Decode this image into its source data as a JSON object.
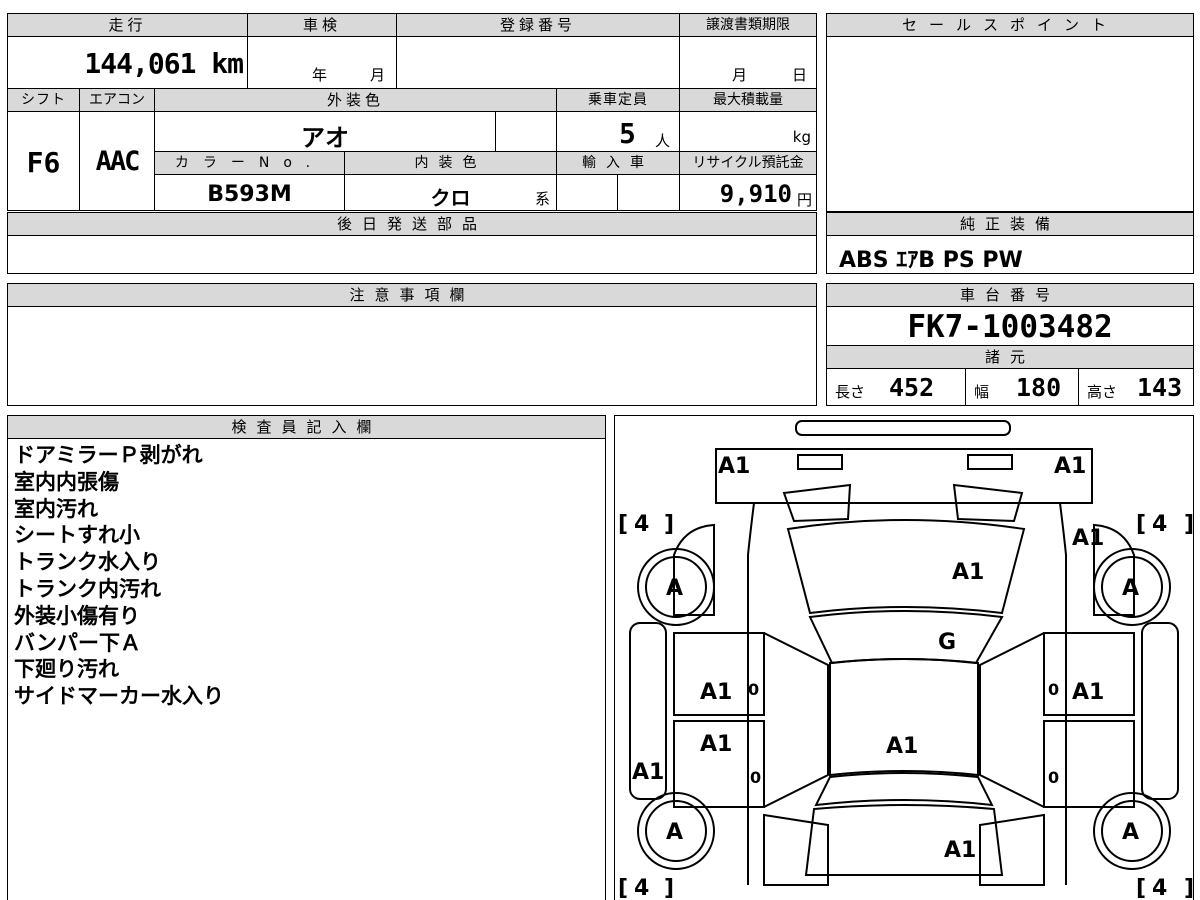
{
  "vehicle": {
    "mileage_header": "走行",
    "mileage_value": "144,061 km",
    "inspection_header": "車検",
    "inspection_year_unit": "年",
    "inspection_month_unit": "月",
    "registration_header": "登録番号",
    "transfer_deadline_header": "譲渡書類期限",
    "transfer_month_unit": "月",
    "transfer_day_unit": "日",
    "shift_header": "シフト",
    "shift_value": "F6",
    "aircon_header": "エアコン",
    "aircon_value": "AAC",
    "exterior_color_header": "外装色",
    "exterior_color_value": "アオ",
    "capacity_header": "乗車定員",
    "capacity_value": "5",
    "capacity_unit": "人",
    "max_load_header": "最大積載量",
    "max_load_unit": "kg",
    "color_no_header": "カラーNo.",
    "color_no_value": "B593M",
    "interior_color_header": "内装色",
    "interior_color_value": "クロ",
    "interior_color_suffix": "系",
    "import_header": "輸入車",
    "recycle_header": "リサイクル預託金",
    "recycle_value": "9,910",
    "recycle_unit": "円",
    "later_parts_header": "後日発送部品"
  },
  "sales_point": {
    "header": "セールスポイント"
  },
  "equipment": {
    "header": "純正装備",
    "value": "ABS ｴｱB PS PW"
  },
  "caution": {
    "header": "注意事項欄"
  },
  "chassis": {
    "header": "車台番号",
    "value": "FK7-1003482"
  },
  "specs": {
    "header": "諸元",
    "length_label": "長さ",
    "length_value": "452",
    "width_label": "幅",
    "width_value": "180",
    "height_label": "高さ",
    "height_value": "143"
  },
  "inspector": {
    "header": "検査員記入欄",
    "notes": [
      "ドアミラーＰ剥がれ",
      "室内内張傷",
      "室内汚れ",
      "シートすれ小",
      "トランク水入り",
      "トランク内汚れ",
      "外装小傷有り",
      "バンパー下Ａ",
      "下廻り汚れ",
      "サイドマーカー水入り"
    ]
  },
  "diagram": {
    "tire_fl": "4",
    "tire_fr": "4",
    "tire_rl": "4",
    "tire_rr": "4",
    "mirror_l": "A1",
    "mirror_r": "A1",
    "front_fender_r": "A1",
    "hood": "A1",
    "wheel_fl": "A",
    "wheel_fr": "A",
    "wheel_rl": "A",
    "wheel_rr": "A",
    "windshield": "G",
    "front_door_l": "A1",
    "front_door_r": "A1",
    "rear_door_l": "A1",
    "roof": "A1",
    "rocker_l": "A1",
    "trunk": "A1",
    "zero_1": "0",
    "zero_2": "0",
    "zero_3": "0",
    "zero_4": "0"
  }
}
